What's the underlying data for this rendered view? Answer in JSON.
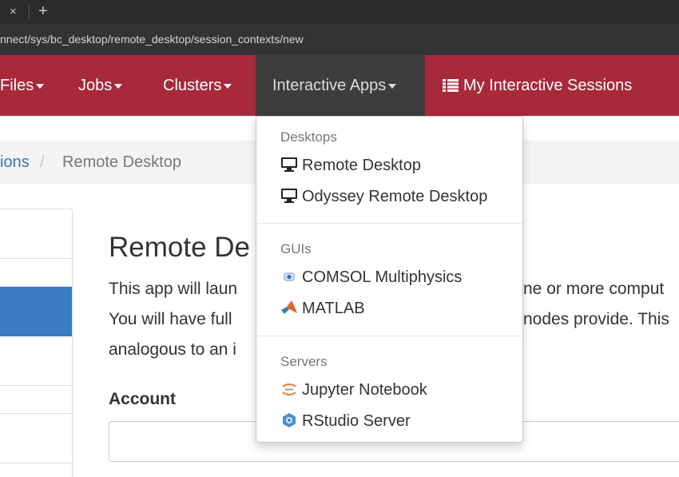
{
  "browser": {
    "tab_close": "×",
    "new_tab": "+",
    "url": "nnect/sys/bc_desktop/remote_desktop/session_contexts/new"
  },
  "navbar": {
    "files": "Files",
    "jobs": "Jobs",
    "clusters": "Clusters",
    "interactive_apps": "Interactive Apps",
    "sessions": "My Interactive Sessions"
  },
  "breadcrumb": {
    "link": "ions",
    "separator": "/",
    "current": "Remote Desktop"
  },
  "main": {
    "title": "Remote De",
    "lines": [
      "This app will laun",
      "You will have full",
      "analogous to an i"
    ],
    "lines_right": [
      "ne or more comput",
      "nodes provide. This"
    ],
    "account_label": "Account"
  },
  "dropdown": {
    "sections": [
      {
        "header": "Desktops",
        "items": [
          "Remote Desktop",
          "Odyssey Remote Desktop"
        ]
      },
      {
        "header": "GUIs",
        "items": [
          "COMSOL Multiphysics",
          "MATLAB"
        ]
      },
      {
        "header": "Servers",
        "items": [
          "Jupyter Notebook",
          "RStudio Server"
        ]
      }
    ]
  },
  "colors": {
    "navbar": "#a7293a",
    "nav_active": "#3d3d3f",
    "link": "#3a76b5",
    "sidebar_active": "#3a7bc4"
  },
  "icons": {
    "desktop": "monitor-icon",
    "comsol": "comsol-icon",
    "matlab": "matlab-icon",
    "jupyter": "jupyter-icon",
    "rstudio": "rstudio-icon",
    "sessions": "list-icon"
  }
}
